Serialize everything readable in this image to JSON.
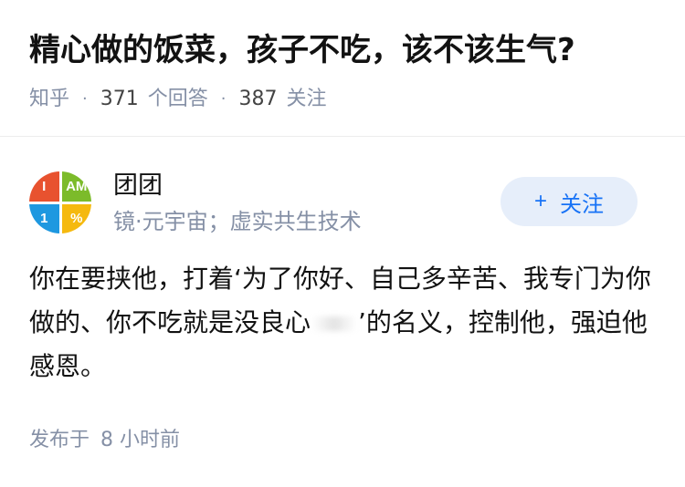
{
  "question": {
    "title": "精心做的饭菜，孩子不吃，该不该生气?",
    "source": "知乎",
    "answer_count": "371",
    "answer_label": "个回答",
    "follower_count": "387",
    "follower_label": "关注"
  },
  "answer": {
    "author": {
      "name": "团团",
      "bio": "镜·元宇宙；虚实共生技术",
      "avatar_letters": [
        "I",
        "AM",
        "1",
        "%"
      ]
    },
    "follow_button": {
      "icon": "+",
      "label": "关注"
    },
    "content_before": "你在要挟他，打着‘为了你好、自己多辛苦、我专门为你做的、你不吃就是没良心",
    "content_after": "’的名义，控制他，强迫他感恩。",
    "published_label": "发布于",
    "published_time": "8 小时前"
  },
  "colors": {
    "accent": "#1772f6",
    "meta": "#8590a6",
    "follow_bg": "#e6eefa"
  }
}
